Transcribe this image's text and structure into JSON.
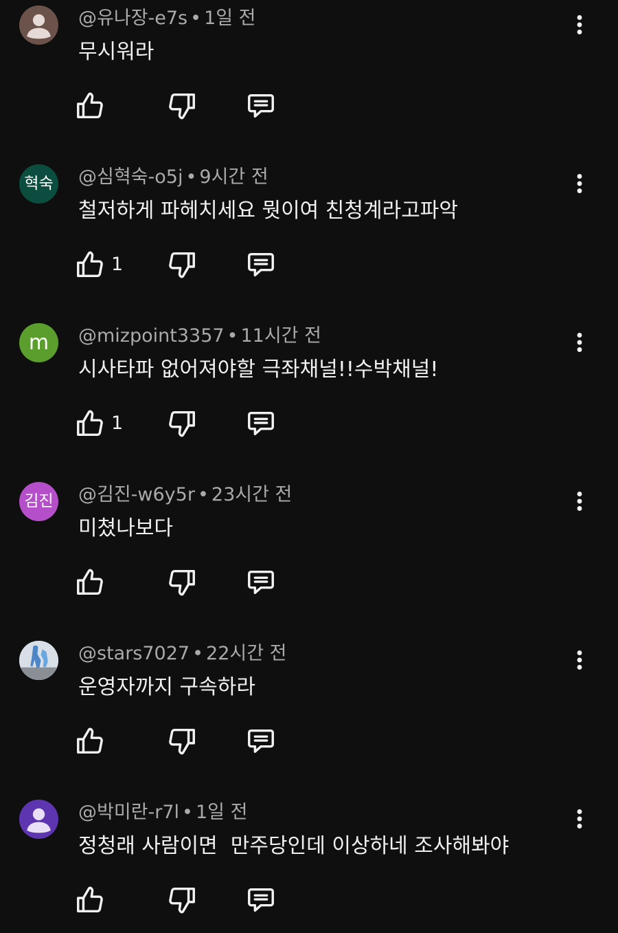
{
  "comments": [
    {
      "avatar": {
        "type": "person",
        "bg": "#6b524a",
        "fg": "#e6dad6",
        "text": ""
      },
      "author": "@유나장-e7s",
      "time": "1일 전",
      "text": "무시워라",
      "likes": ""
    },
    {
      "avatar": {
        "type": "initials",
        "bg": "#0b4d3e",
        "text": "혁숙"
      },
      "author": "@심혁숙-o5j",
      "time": "9시간 전",
      "text": "철저하게 파헤치세요 뭣이여 친청계라고파악",
      "likes": "1"
    },
    {
      "avatar": {
        "type": "initials-big",
        "bg": "#5b9e2d",
        "text": "m"
      },
      "author": "@mizpoint3357",
      "time": "11시간 전",
      "text": "시사타파 없어져야할 극좌채널!!수박채널!",
      "likes": "1"
    },
    {
      "avatar": {
        "type": "initials",
        "bg": "#b44fc9",
        "text": "김진"
      },
      "author": "@김진-w6y5r",
      "time": "23시간 전",
      "text": "미쳤나보다",
      "likes": ""
    },
    {
      "avatar": {
        "type": "photo",
        "bg": "#c9d4df",
        "text": ""
      },
      "author": "@stars7027",
      "time": "22시간 전",
      "text": "운영자까지 구속하라",
      "likes": ""
    },
    {
      "avatar": {
        "type": "person",
        "bg": "#5e35b1",
        "fg": "#e9e0f7",
        "text": ""
      },
      "author": "@박미란-r7l",
      "time": "1일 전",
      "text": "정청래 사람이면  만주당인데 이상하네 조사해봐야",
      "likes": ""
    }
  ]
}
